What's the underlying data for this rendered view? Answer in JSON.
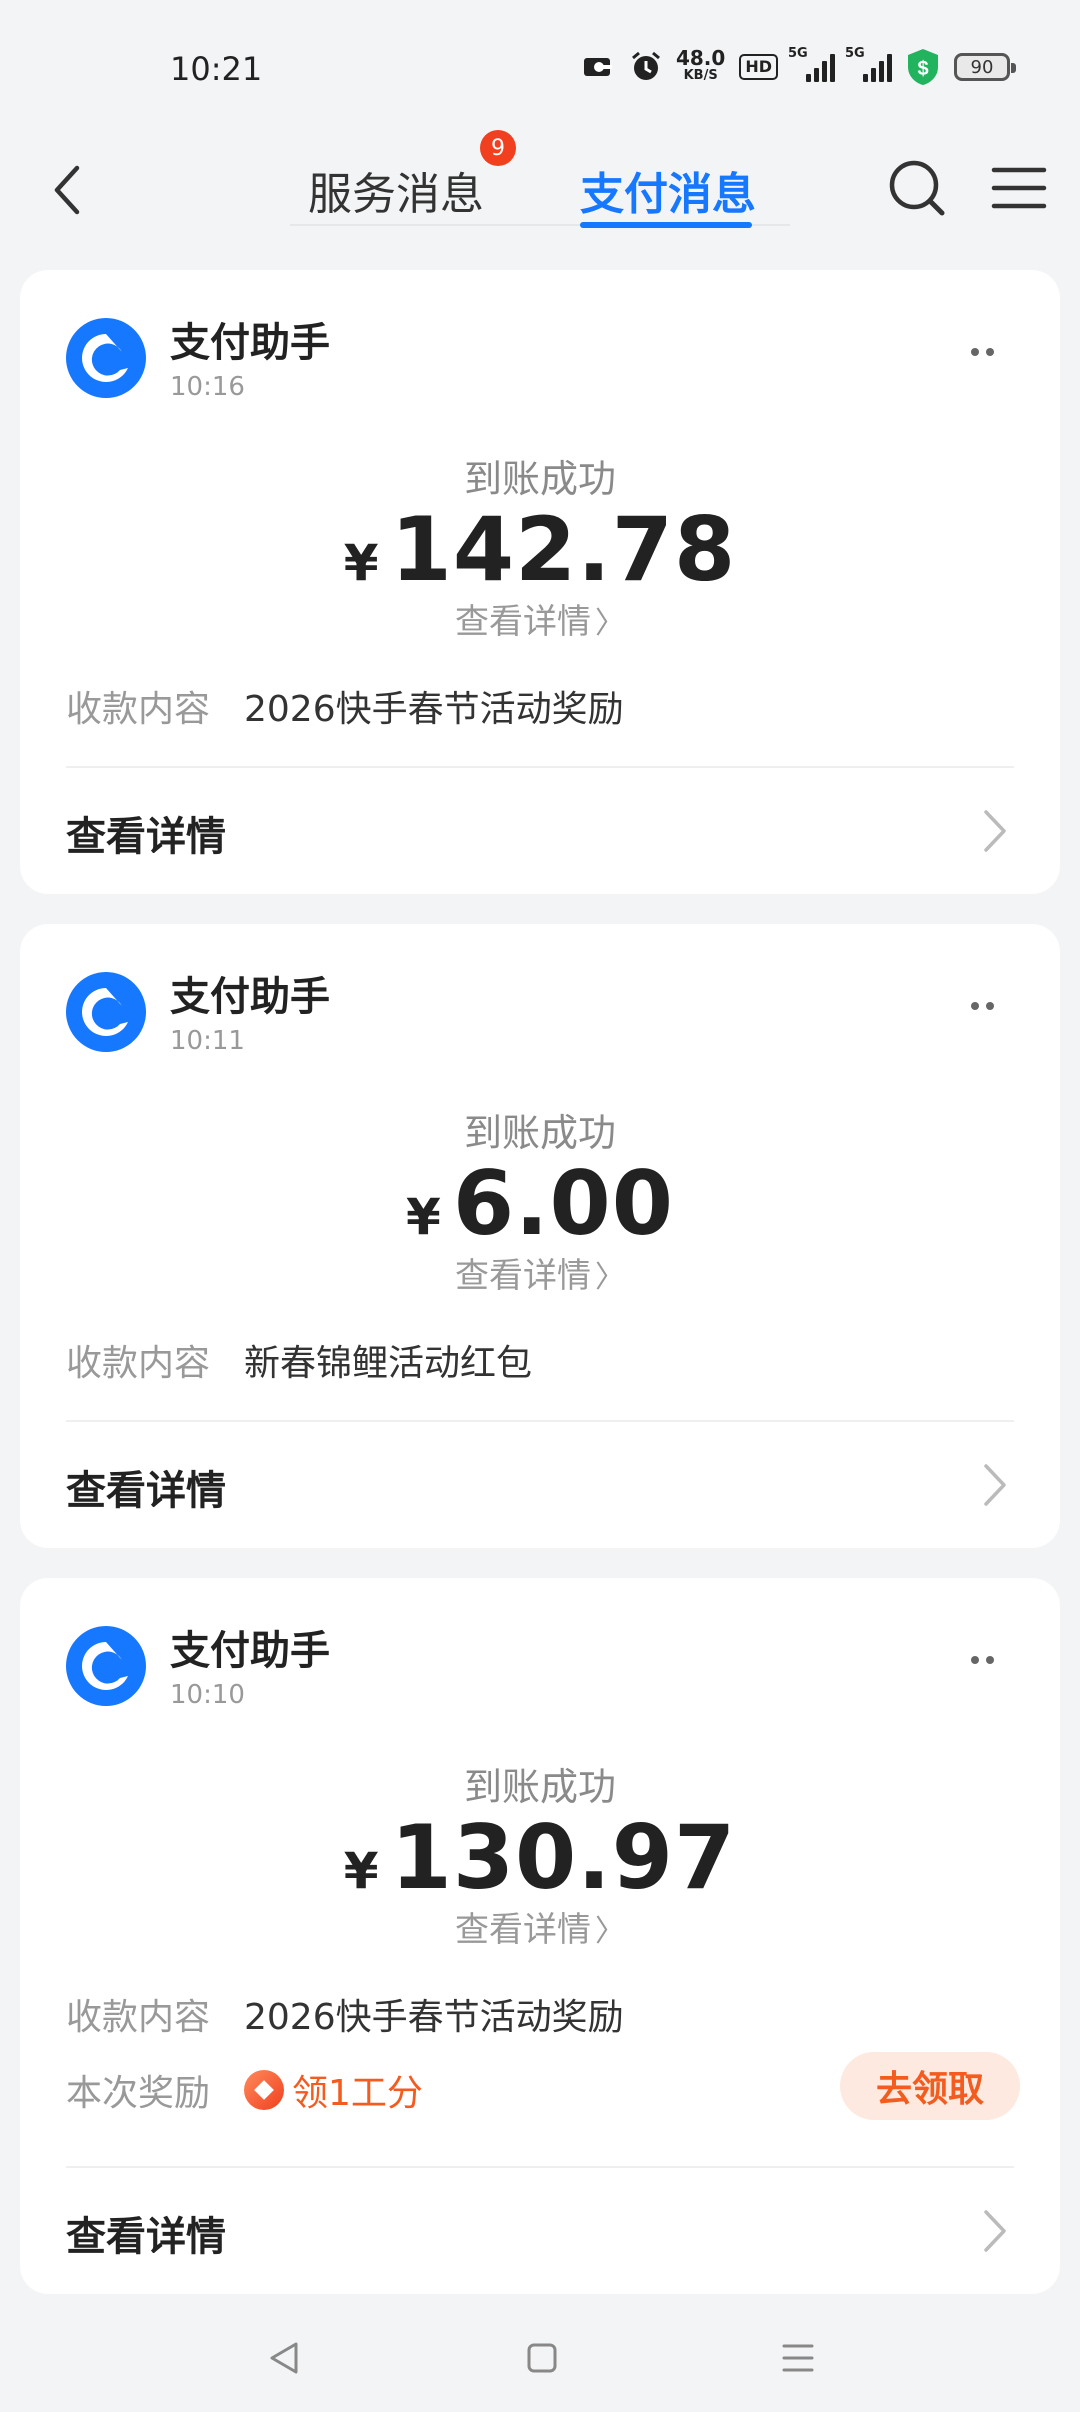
{
  "status_bar": {
    "time": "10:21",
    "net_speed": "48.0",
    "net_unit": "KB/S",
    "hd": "HD",
    "signal1_tag": "5G",
    "signal2_tag": "5G",
    "battery": "90"
  },
  "header": {
    "tab_service": "服务消息",
    "tab_service_badge": "9",
    "tab_pay": "支付消息",
    "active_tab": "支付消息",
    "accent_color": "#1677ff"
  },
  "messages": [
    {
      "sender": "支付助手",
      "time": "10:16",
      "status": "到账成功",
      "currency": "¥",
      "amount": "142.78",
      "detail_link": "查看详情",
      "info_label": "收款内容",
      "info_value": "2026快手春节活动奖励",
      "footer": "查看详情"
    },
    {
      "sender": "支付助手",
      "time": "10:11",
      "status": "到账成功",
      "currency": "¥",
      "amount": "6.00",
      "detail_link": "查看详情",
      "info_label": "收款内容",
      "info_value": "新春锦鲤活动红包",
      "footer": "查看详情"
    },
    {
      "sender": "支付助手",
      "time": "10:10",
      "status": "到账成功",
      "currency": "¥",
      "amount": "130.97",
      "detail_link": "查看详情",
      "info_label": "收款内容",
      "info_value": "2026快手春节活动奖励",
      "reward_label": "本次奖励",
      "reward_value": "领1工分",
      "claim_button": "去领取",
      "footer": "查看详情"
    }
  ]
}
